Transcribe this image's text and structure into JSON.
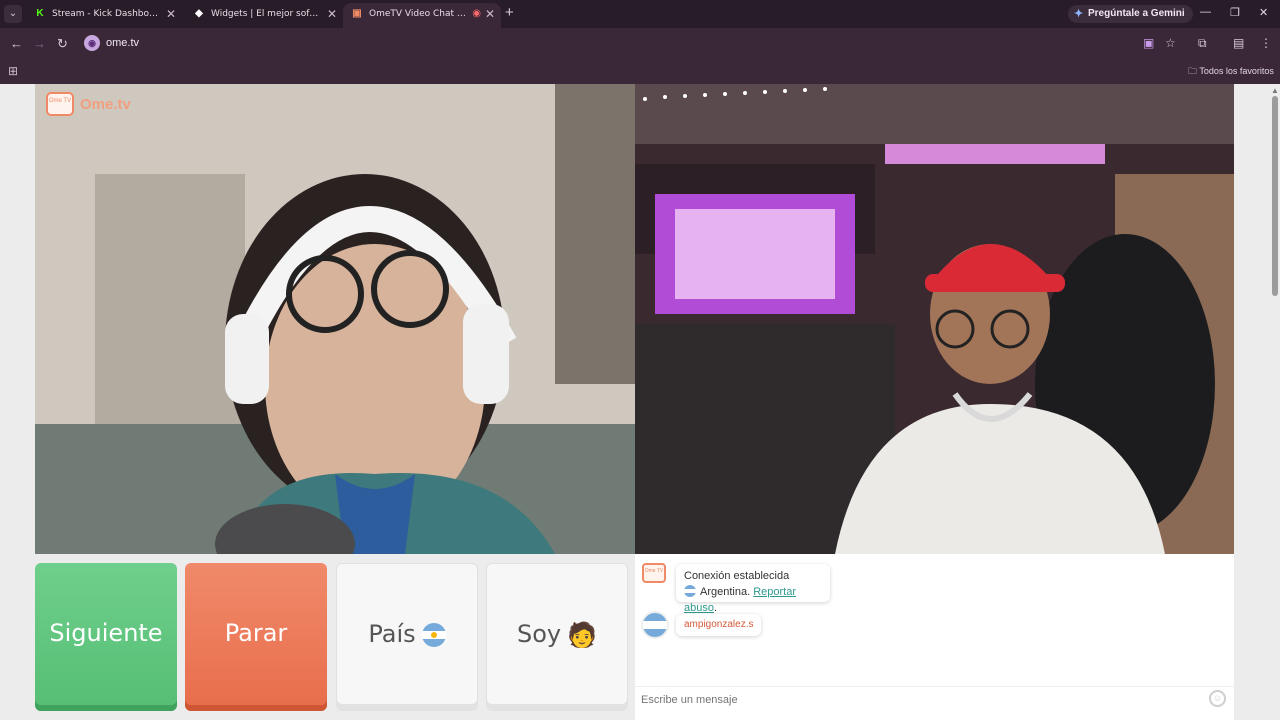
{
  "tabs": [
    {
      "title": "Stream - Kick Dashboard",
      "favicon": "kick-icon",
      "color": "#53fc18",
      "active": false
    },
    {
      "title": "Widgets | El mejor software para",
      "favicon": "widgets-icon",
      "color": "#ffffff",
      "active": false
    },
    {
      "title": "OmeTV Video Chat — Ome",
      "favicon": "ometv-icon",
      "color": "#f08a66",
      "active": true
    }
  ],
  "gemini_label": "Pregúntale a Gemini",
  "address": "ome.tv",
  "bookmarks_label": "Todos los favoritos",
  "logo_text": "Ome.tv",
  "logo_tv": "Ome TV",
  "buttons": {
    "next": "Siguiente",
    "stop": "Parar",
    "country": "País",
    "me": "Soy"
  },
  "chat": {
    "connection": "Conexión establecida",
    "country": "Argentina.",
    "report": "Reportar abuso",
    "report_suffix": ".",
    "partner_name": "ampigonzalez.s",
    "input_placeholder": "Escribe un mensaje"
  },
  "colors": {
    "next": "#55be74",
    "stop": "#e86d4c",
    "accent": "#f08a66",
    "report_link": "#2e9a8e"
  }
}
